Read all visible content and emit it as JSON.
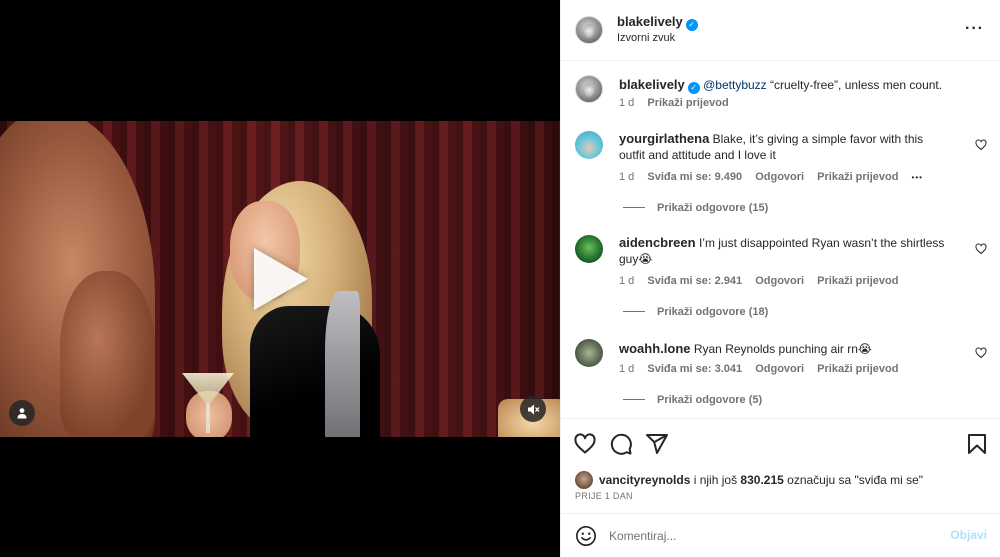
{
  "post": {
    "author": "blakelively",
    "audio": "Izvorni zvuk",
    "caption": {
      "username": "blakelively",
      "mention": "@bettybuzz",
      "text": "“cruelty-free”, unless men count.",
      "age": "1 d",
      "translate": "Prikaži prijevod"
    }
  },
  "comments": [
    {
      "username": "yourgirlathena",
      "text": "Blake, it’s giving a simple favor with this outfit and attitude and I love it",
      "age": "1 d",
      "likes": "Sviđa mi se: 9.490",
      "reply": "Odgovori",
      "translate": "Prikaži prijevod",
      "more": "•••",
      "view_replies": "Prikaži odgovore (15)"
    },
    {
      "username": "aidencbreen",
      "text": "I’m just disappointed Ryan wasn’t the shirtless guy😭",
      "age": "1 d",
      "likes": "Sviđa mi se: 2.941",
      "reply": "Odgovori",
      "translate": "Prikaži prijevod",
      "view_replies": "Prikaži odgovore (18)"
    },
    {
      "username": "woahh.lone",
      "text": "Ryan Reynolds punching air rn😭",
      "age": "1 d",
      "likes": "Sviđa mi se: 3.041",
      "reply": "Odgovori",
      "translate": "Prikaži prijevod",
      "view_replies": "Prikaži odgovore (5)"
    }
  ],
  "likes_summary": {
    "user": "vancityreynolds",
    "connector": "i njih još",
    "count": "830.215",
    "suffix": "označuju sa \"sviđa mi se\""
  },
  "date": "PRIJE 1 DAN",
  "comment_box": {
    "placeholder": "Komentiraj...",
    "post_label": "Objavi"
  },
  "icons": {
    "like": "heart-icon",
    "comment": "comment-icon",
    "share": "share-icon",
    "save": "bookmark-icon",
    "emoji": "emoji-icon",
    "play": "play-icon",
    "mute": "muted-speaker-icon",
    "tagged": "person-icon",
    "more": "more-horizontal-icon"
  },
  "colors": {
    "verified": "#0095f6",
    "link": "#00376b",
    "secondary_text": "#737373",
    "post_disabled": "#b2dffc"
  }
}
